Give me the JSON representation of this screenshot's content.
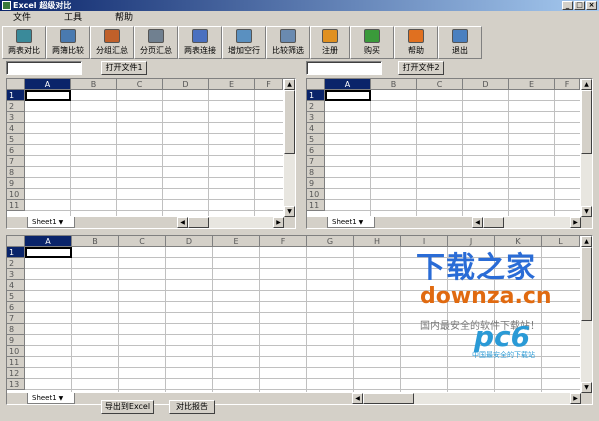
{
  "window": {
    "title": "Excel 超级对比"
  },
  "menu": [
    "文件",
    "工具",
    "帮助"
  ],
  "toolbar": [
    {
      "label": "两表对比",
      "icon": "table-compare-icon",
      "color": "#3a8a9a"
    },
    {
      "label": "两簿比较",
      "icon": "workbook-compare-icon",
      "color": "#4a7ab0"
    },
    {
      "label": "分组汇总",
      "icon": "group-sum-icon",
      "color": "#c0602a"
    },
    {
      "label": "分页汇总",
      "icon": "page-sum-icon",
      "color": "#708090"
    },
    {
      "label": "两表连接",
      "icon": "table-join-icon",
      "color": "#4a70c0"
    },
    {
      "label": "增加空行",
      "icon": "add-row-icon",
      "color": "#5a90c0"
    },
    {
      "label": "比较筛选",
      "icon": "compare-filter-icon",
      "color": "#6a8ab0"
    },
    {
      "label": "注册",
      "icon": "register-icon",
      "color": "#e09020"
    },
    {
      "label": "购买",
      "icon": "buy-icon",
      "color": "#3a9a3a"
    },
    {
      "label": "帮助",
      "icon": "help-icon",
      "color": "#e07020"
    },
    {
      "label": "退出",
      "icon": "exit-icon",
      "color": "#4a80c0"
    }
  ],
  "file1": {
    "input_value": "",
    "open_button": "打开文件1"
  },
  "file2": {
    "input_value": "",
    "open_button": "打开文件2"
  },
  "columns_top": [
    "A",
    "B",
    "C",
    "D",
    "E",
    "F"
  ],
  "rows_top": [
    "1",
    "2",
    "3",
    "4",
    "5",
    "6",
    "7",
    "8",
    "9",
    "10",
    "11"
  ],
  "columns_bottom": [
    "A",
    "B",
    "C",
    "D",
    "E",
    "F",
    "G",
    "H",
    "I",
    "J",
    "K",
    "L"
  ],
  "rows_bottom": [
    "1",
    "2",
    "3",
    "4",
    "5",
    "6",
    "7",
    "8",
    "9",
    "10",
    "11",
    "12",
    "13"
  ],
  "sheet_tab": "Sheet1",
  "bottom_buttons": {
    "export": "导出到Excel",
    "report": "对比报告"
  },
  "watermark": {
    "brand": "下载之家",
    "domain": "downza.cn",
    "slogan": "国内最安全的软件下载站！",
    "logo": "pc6",
    "logo_sub": "中国最安全的下载站"
  }
}
